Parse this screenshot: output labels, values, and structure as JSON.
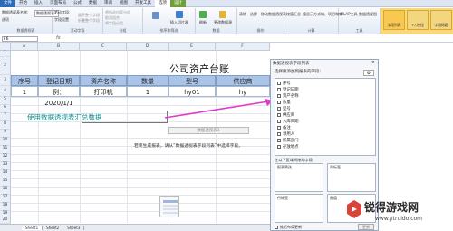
{
  "ribbon": {
    "tabs": [
      "文件",
      "开始",
      "插入",
      "页面布局",
      "公式",
      "数据",
      "审阅",
      "视图",
      "开发工具",
      "选项",
      "设计"
    ],
    "pivot_name_label": "数据透视表名称:",
    "pivot_name_value": "数据透视表1",
    "options_label": "选项",
    "active_field_label": "活动字段:",
    "field_settings": "字段设置",
    "expand_field": "展开整个字段",
    "collapse_field": "折叠整个字段",
    "group_selection": "将所选内容分组",
    "ungroup": "取消组合",
    "group_field": "将字段分组",
    "insert_slicer": "插入切片器",
    "refresh": "刷新",
    "change_source": "更改数据源",
    "clear": "清除",
    "select": "选择",
    "move_pivot": "移动数据透视表",
    "calculations": "计算",
    "summarize": "按值汇总",
    "show_values": "值显示方式",
    "fields_items": "域、项目和集",
    "olap_tools": "OLAP工具",
    "pivot_chart": "数据透视图",
    "field_list": "字段列表",
    "buttons": "+/-按钮",
    "headers": "字段标题",
    "groups": [
      "数据透视表",
      "活动字段",
      "分组",
      "排序和筛选",
      "数据",
      "操作",
      "计算",
      "工具",
      "显示"
    ]
  },
  "formula_bar": {
    "name_box": "F6",
    "fx": "fx"
  },
  "columns": [
    "A",
    "B",
    "C",
    "D",
    "E",
    "F"
  ],
  "rows": [
    "1",
    "2",
    "3",
    "4",
    "5",
    "6",
    "7",
    "8",
    "9",
    "10",
    "11",
    "12",
    "13",
    "14",
    "15",
    "16",
    "17",
    "18",
    "19",
    "20"
  ],
  "sheet": {
    "title": "公司资产台账",
    "headers": [
      "序号",
      "登记日期",
      "资产名称",
      "数量",
      "型号",
      "供应商"
    ],
    "row": [
      "1",
      "例：2020/1/1",
      "打印机",
      "1",
      "hy01",
      "hy"
    ]
  },
  "pivot": {
    "link_text": "使用数据透视表汇总数据",
    "area_text": "数据透视表1",
    "hint_text": "若要生成报表，请从“数据透视表字段列表”中选择字段。"
  },
  "sheet_tabs": [
    "Sheet1",
    "Sheet2",
    "Sheet3"
  ],
  "pane": {
    "title": "数据透视表字段列表",
    "close": "×",
    "choose_label": "选择要添加到报表的字段:",
    "fields": [
      "序号",
      "登记日期",
      "资产名称",
      "数量",
      "型号",
      "供应商",
      "入库日期",
      "备注",
      "领用人",
      "所属部门",
      "存放地点"
    ],
    "drag_label": "在以下区域间拖动字段:",
    "zones": [
      "报表筛选",
      "列标签",
      "行标签",
      "数值"
    ],
    "defer_label": "推迟布局更新",
    "update": "更新"
  },
  "watermark": {
    "name": "锐得游戏网",
    "url": "www.ytruido.com"
  },
  "colors": {
    "header_fill": "#a9c4e6",
    "link_teal": "#0f8d8d",
    "arrow": "#e03cc8",
    "field_list_active": "#f9c84f"
  }
}
